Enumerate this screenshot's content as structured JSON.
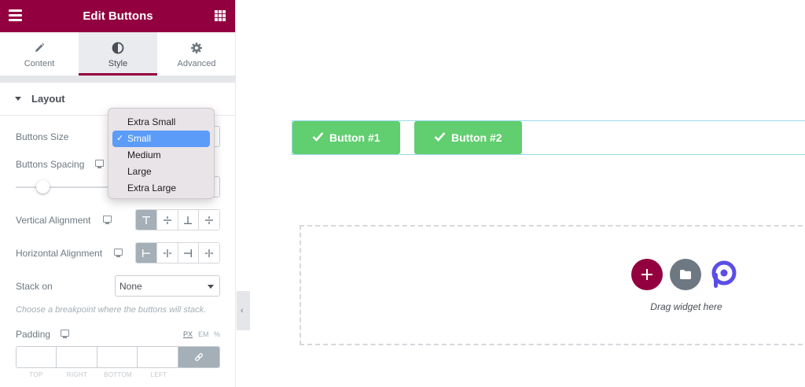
{
  "header": {
    "title": "Edit Buttons"
  },
  "tabs": [
    {
      "label": "Content",
      "icon": "pencil-icon"
    },
    {
      "label": "Style",
      "icon": "half-circle-icon",
      "active": true
    },
    {
      "label": "Advanced",
      "icon": "gear-icon"
    }
  ],
  "section": {
    "title": "Layout"
  },
  "controls": {
    "buttons_size": "Buttons Size",
    "buttons_spacing": "Buttons Spacing",
    "vertical_alignment": "Vertical Alignment",
    "horizontal_alignment": "Horizontal Alignment",
    "stack_on": "Stack on",
    "stack_on_value": "None",
    "stack_hint": "Choose a breakpoint where the buttons will stack.",
    "padding": "Padding",
    "units": [
      "PX",
      "EM",
      "%"
    ],
    "padding_fields": [
      "TOP",
      "RIGHT",
      "BOTTOM",
      "LEFT"
    ]
  },
  "size_dropdown": {
    "options": [
      "Extra Small",
      "Small",
      "Medium",
      "Large",
      "Extra Large"
    ],
    "selected": "Small",
    "check": "✓"
  },
  "canvas": {
    "buttons": [
      "Button #1",
      "Button #2"
    ],
    "drop_text": "Drag widget here"
  },
  "colors": {
    "brand": "#93003f",
    "button_green": "#61ce70",
    "selection_blue": "#5b9cf8",
    "active_choice": "#a4afb7"
  }
}
